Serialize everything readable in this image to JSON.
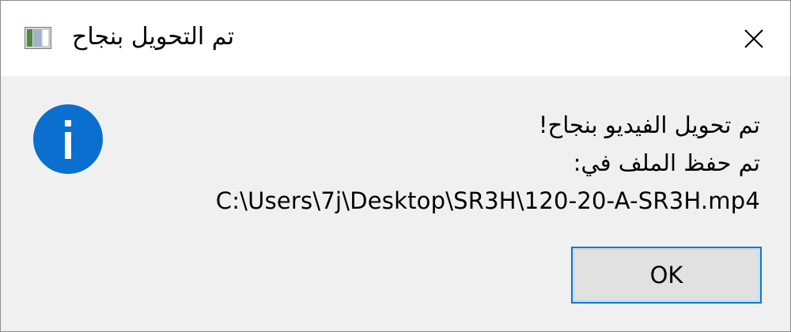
{
  "window": {
    "title": "تم التحويل بنجاح",
    "app_icon": "app-window-icon",
    "close_icon": "close-icon"
  },
  "dialog": {
    "icon": "info-icon",
    "line1": "تم تحويل الفيديو بنجاح!",
    "line2": "تم حفظ الملف في:",
    "path": "C:\\Users\\7j\\Desktop\\SR3H\\120-20-A-SR3H.mp4"
  },
  "buttons": {
    "ok_label": "OK"
  },
  "colors": {
    "accent": "#0078d7",
    "info": "#0a6fcf",
    "background": "#f0f0f0"
  }
}
